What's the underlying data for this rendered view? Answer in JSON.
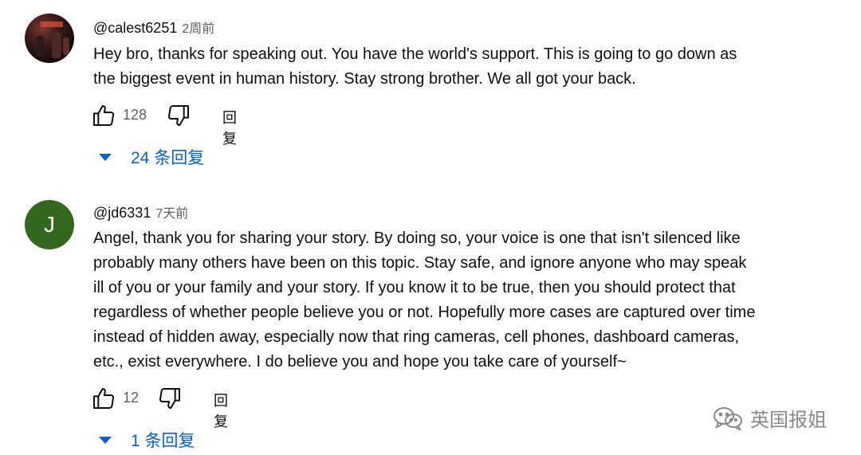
{
  "comments": [
    {
      "author": "@calest6251",
      "time": "2周前",
      "avatar_type": "photo",
      "lines": [
        "Hey bro, thanks for speaking out. You have the world's support. This is going to go down as",
        "the biggest event in human history. Stay strong brother. We all got your back."
      ],
      "likes": "128",
      "reply_label": "回复",
      "replies_label": "24 条回复",
      "icons": [
        "thumb-up-icon",
        "thumb-down-icon",
        "caret-down-icon"
      ]
    },
    {
      "author": "@jd6331",
      "time": "7天前",
      "avatar_type": "letter",
      "avatar_letter": "J",
      "avatar_color": "#33691e",
      "lines": [
        "Angel, thank you for sharing your story. By doing so, your voice is one that isn't silenced like",
        "probably many others have been on this topic. Stay safe, and ignore anyone who may speak",
        "ill of you or your family and your story. If you know it to be true, then you should protect that",
        "regardless of whether people believe you or not. Hopefully more cases are captured over time",
        "instead of hidden away, especially now that ring cameras, cell phones, dashboard cameras,",
        "etc., exist everywhere. I do believe you and hope you take care of yourself~"
      ],
      "likes": "12",
      "reply_label": "回复",
      "replies_label": "1 条回复",
      "icons": [
        "thumb-up-icon",
        "thumb-down-icon",
        "caret-down-icon"
      ]
    }
  ],
  "watermark": {
    "text": "英国报姐",
    "icon": "wechat-icon"
  },
  "colors": {
    "link_blue": "#065fd4",
    "secondary_text": "#606060",
    "primary_text": "#0f0f0f"
  }
}
